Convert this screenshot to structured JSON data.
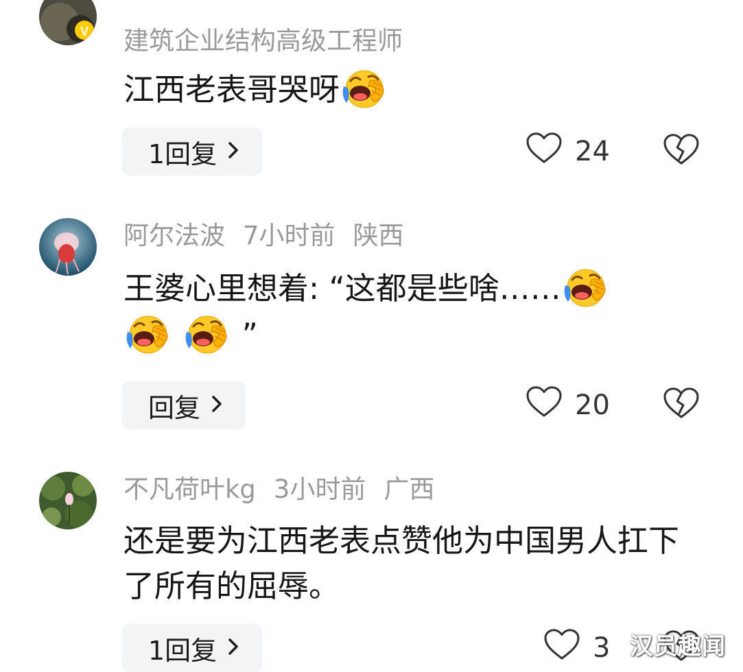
{
  "comments": [
    {
      "username": "建筑企业结构高级工程师",
      "time": "",
      "location": "",
      "text_before": "江西老表哥哭呀",
      "text_after": "",
      "reply_label": "1回复",
      "likes": "24"
    },
    {
      "username": "阿尔法波",
      "time": "7小时前",
      "location": "陕西",
      "text_before": "王婆心里想着: “这都是些啥……",
      "text_after": "”",
      "reply_label": "回复",
      "likes": "20"
    },
    {
      "username": "不凡荷叶kg",
      "time": "3小时前",
      "location": "广西",
      "text_before": "还是要为江西老表点赞他为中国男人扛下了所有的屈辱。",
      "text_after": "",
      "reply_label": "1回复",
      "likes": "3"
    }
  ],
  "icons": {
    "emoji": "laugh-cry-emoji-icon",
    "like": "heart-outline-icon",
    "dislike": "broken-heart-icon",
    "chevron": "chevron-right-icon"
  },
  "watermark": "汉员趣闻",
  "colors": {
    "meta_text": "#9a9a9a",
    "body_text": "#161616",
    "reply_bg": "#f3f4f6",
    "emoji_yellow": "#ffc928",
    "emoji_tear": "#3d8ef0"
  }
}
